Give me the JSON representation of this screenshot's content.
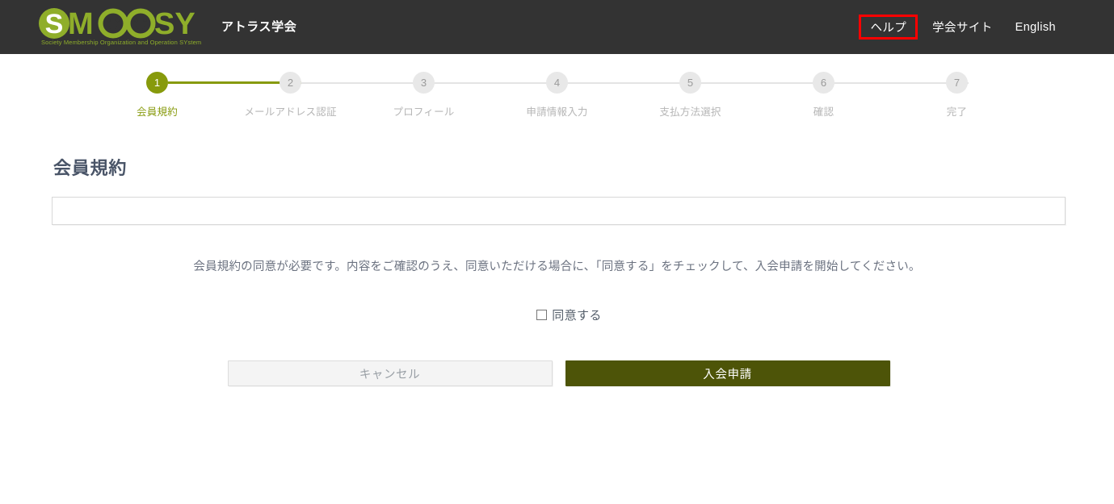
{
  "header": {
    "logo_text": "SMOOSY",
    "logo_tagline": "Society Membership Organization and Operation SYstem",
    "society_name": "アトラス学会",
    "nav": [
      {
        "label": "ヘルプ",
        "highlighted": true,
        "highlight_color": "#ff0000"
      },
      {
        "label": "学会サイト",
        "highlighted": false
      },
      {
        "label": "English",
        "highlighted": false
      }
    ],
    "background_color": "#333333"
  },
  "stepper": {
    "active_color": "#879a0c",
    "inactive_color": "#e8e8e8",
    "current_step": 1,
    "steps": [
      {
        "number": "1",
        "label": "会員規約"
      },
      {
        "number": "2",
        "label": "メールアドレス認証"
      },
      {
        "number": "3",
        "label": "プロフィール"
      },
      {
        "number": "4",
        "label": "申請情報入力"
      },
      {
        "number": "5",
        "label": "支払方法選択"
      },
      {
        "number": "6",
        "label": "確認"
      },
      {
        "number": "7",
        "label": "完了"
      }
    ]
  },
  "main": {
    "page_title": "会員規約",
    "terms_panel_content": "",
    "notice": "会員規約の同意が必要です。内容をご確認のうえ、同意いただける場合に、「同意する」をチェックして、入会申請を開始してください。",
    "agree_label": "同意する",
    "agree_checked": false,
    "buttons": {
      "cancel_label": "キャンセル",
      "submit_label": "入会申請",
      "submit_color": "#4d5408"
    }
  }
}
